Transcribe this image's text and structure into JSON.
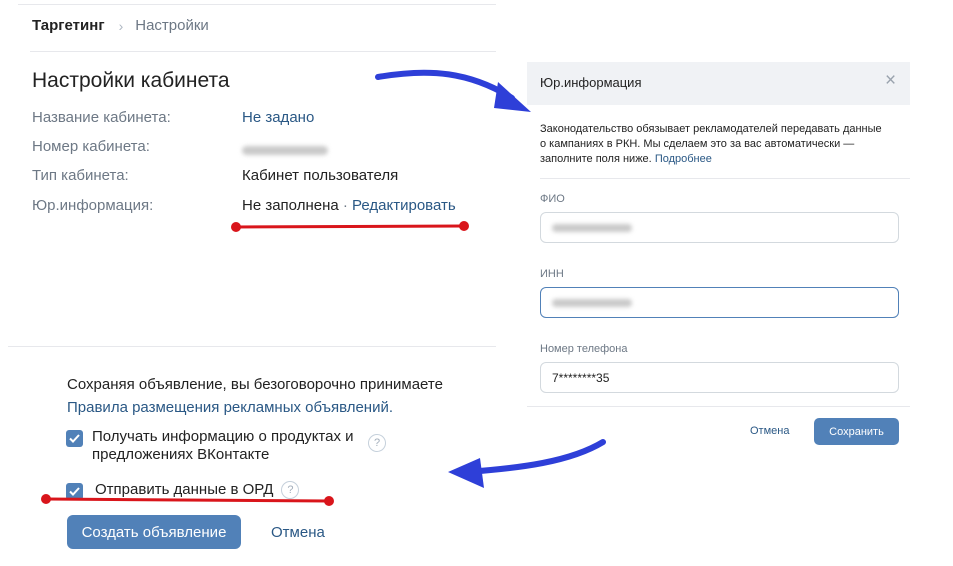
{
  "breadcrumb": {
    "active": "Таргетинг",
    "separator": "›",
    "current": "Настройки"
  },
  "page": {
    "title": "Настройки кабинета",
    "rows": [
      {
        "label": "Название кабинета:",
        "value": "Не задано"
      },
      {
        "label": "Номер кабинета:"
      },
      {
        "label": "Тип кабинета:",
        "value": "Кабинет пользователя"
      },
      {
        "label": "Юр.информация:",
        "value": "Не заполнена",
        "sep": " · ",
        "link": "Редактировать"
      }
    ]
  },
  "form": {
    "terms_text": "Сохраняя объявление, вы безоговорочно принимаете",
    "terms_link": "Правила размещения рекламных объявлений.",
    "checkbox1_label": "Получать информацию о продуктах и предложениях ВКонтакте",
    "checkbox1_checked": true,
    "checkbox2_label": "Отправить данные в ОРД",
    "checkbox2_checked": true,
    "help_glyph": "?",
    "create_label": "Создать объявление",
    "cancel_label": "Отмена"
  },
  "modal": {
    "title": "Юр.информация",
    "close_glyph": "×",
    "notice": "Законодательство обязывает рекламодателей передавать данные о кампаниях в РКН. Мы сделаем это за вас автоматически — заполните поля ниже.",
    "notice_link": "Подробнее",
    "fields": [
      {
        "label": "ФИО"
      },
      {
        "label": "ИНН"
      },
      {
        "label": "Номер телефона",
        "value": "7********35"
      }
    ],
    "cancel_label": "Отмена",
    "save_label": "Сохранить"
  },
  "colors": {
    "accent": "#5181b8",
    "link": "#2a5885",
    "annotation_red": "#d9151b",
    "annotation_blue": "#2e3fd8"
  }
}
